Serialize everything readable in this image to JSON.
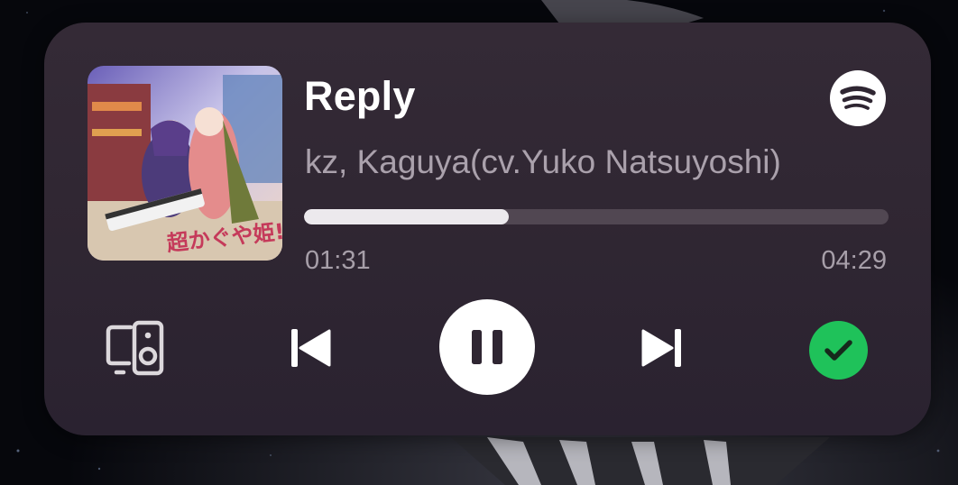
{
  "track": {
    "title": "Reply",
    "artist": "kz, Kaguya(cv.Yuko Natsuyoshi)",
    "album_art_text": "超かぐや姫!"
  },
  "playback": {
    "elapsed": "01:31",
    "duration": "04:29",
    "progress_fraction": 0.35,
    "state": "playing"
  },
  "controls": {
    "devices_icon": "devices-speaker-icon",
    "previous_icon": "skip-previous-icon",
    "pause_icon": "pause-icon",
    "next_icon": "skip-next-icon",
    "saved_icon": "check-icon"
  },
  "app": {
    "logo_icon": "spotify-logo-icon"
  },
  "colors": {
    "widget_background": "#2f2632",
    "accent_green": "#1fc25a",
    "progress_fill": "#ece9ed",
    "progress_track": "#514752",
    "secondary_text": "#aaa1ac"
  }
}
